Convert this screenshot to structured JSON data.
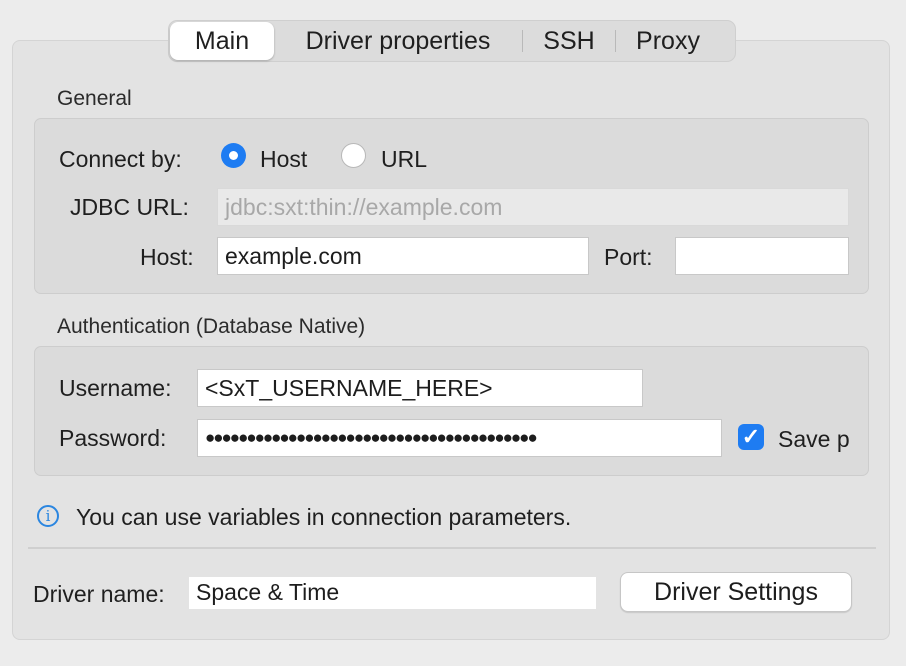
{
  "tabs": [
    "Main",
    "Driver properties",
    "SSH",
    "Proxy"
  ],
  "general": {
    "title": "General",
    "connect_by_label": "Connect by:",
    "option_host": "Host",
    "option_url": "URL",
    "selected": "Host",
    "jdbc_label": "JDBC URL:",
    "jdbc_value": "jdbc:sxt:thin://example.com",
    "host_label": "Host:",
    "host_value": "example.com",
    "port_label": "Port:",
    "port_value": ""
  },
  "auth": {
    "title": "Authentication (Database Native)",
    "username_label": "Username:",
    "username_value": "<SxT_USERNAME_HERE>",
    "password_label": "Password:",
    "password_masked": "●●●●●●●●●●●●●●●●●●●●●●●●●●●●●●●●●●●●●●●●",
    "save_label": "Save p",
    "save_checked": true
  },
  "info_text": "You can use variables in connection parameters.",
  "driver": {
    "name_label": "Driver name:",
    "name_value": "Space & Time",
    "settings_button": "Driver Settings"
  },
  "colors": {
    "accent": "#1e7cf2",
    "info": "#2b86e0"
  }
}
